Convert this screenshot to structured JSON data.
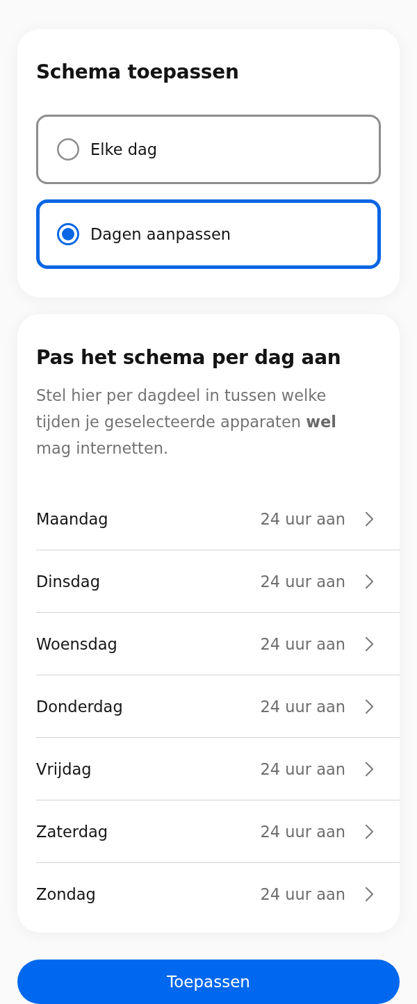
{
  "apply_schedule": {
    "title": "Schema toepassen",
    "options": [
      {
        "label": "Elke dag",
        "selected": false
      },
      {
        "label": "Dagen aanpassen",
        "selected": true
      }
    ]
  },
  "per_day": {
    "title": "Pas het schema per dag aan",
    "description": "Stel hier per dagdeel in tussen welke tijden je geselecteerde apparaten **wel** mag internetten.",
    "days": [
      {
        "day": "Maandag",
        "value": "24 uur aan"
      },
      {
        "day": "Dinsdag",
        "value": "24 uur aan"
      },
      {
        "day": "Woensdag",
        "value": "24 uur aan"
      },
      {
        "day": "Donderdag",
        "value": "24 uur aan"
      },
      {
        "day": "Vrijdag",
        "value": "24 uur aan"
      },
      {
        "day": "Zaterdag",
        "value": "24 uur aan"
      },
      {
        "day": "Zondag",
        "value": "24 uur aan"
      }
    ]
  },
  "apply_button": {
    "label": "Toepassen"
  }
}
